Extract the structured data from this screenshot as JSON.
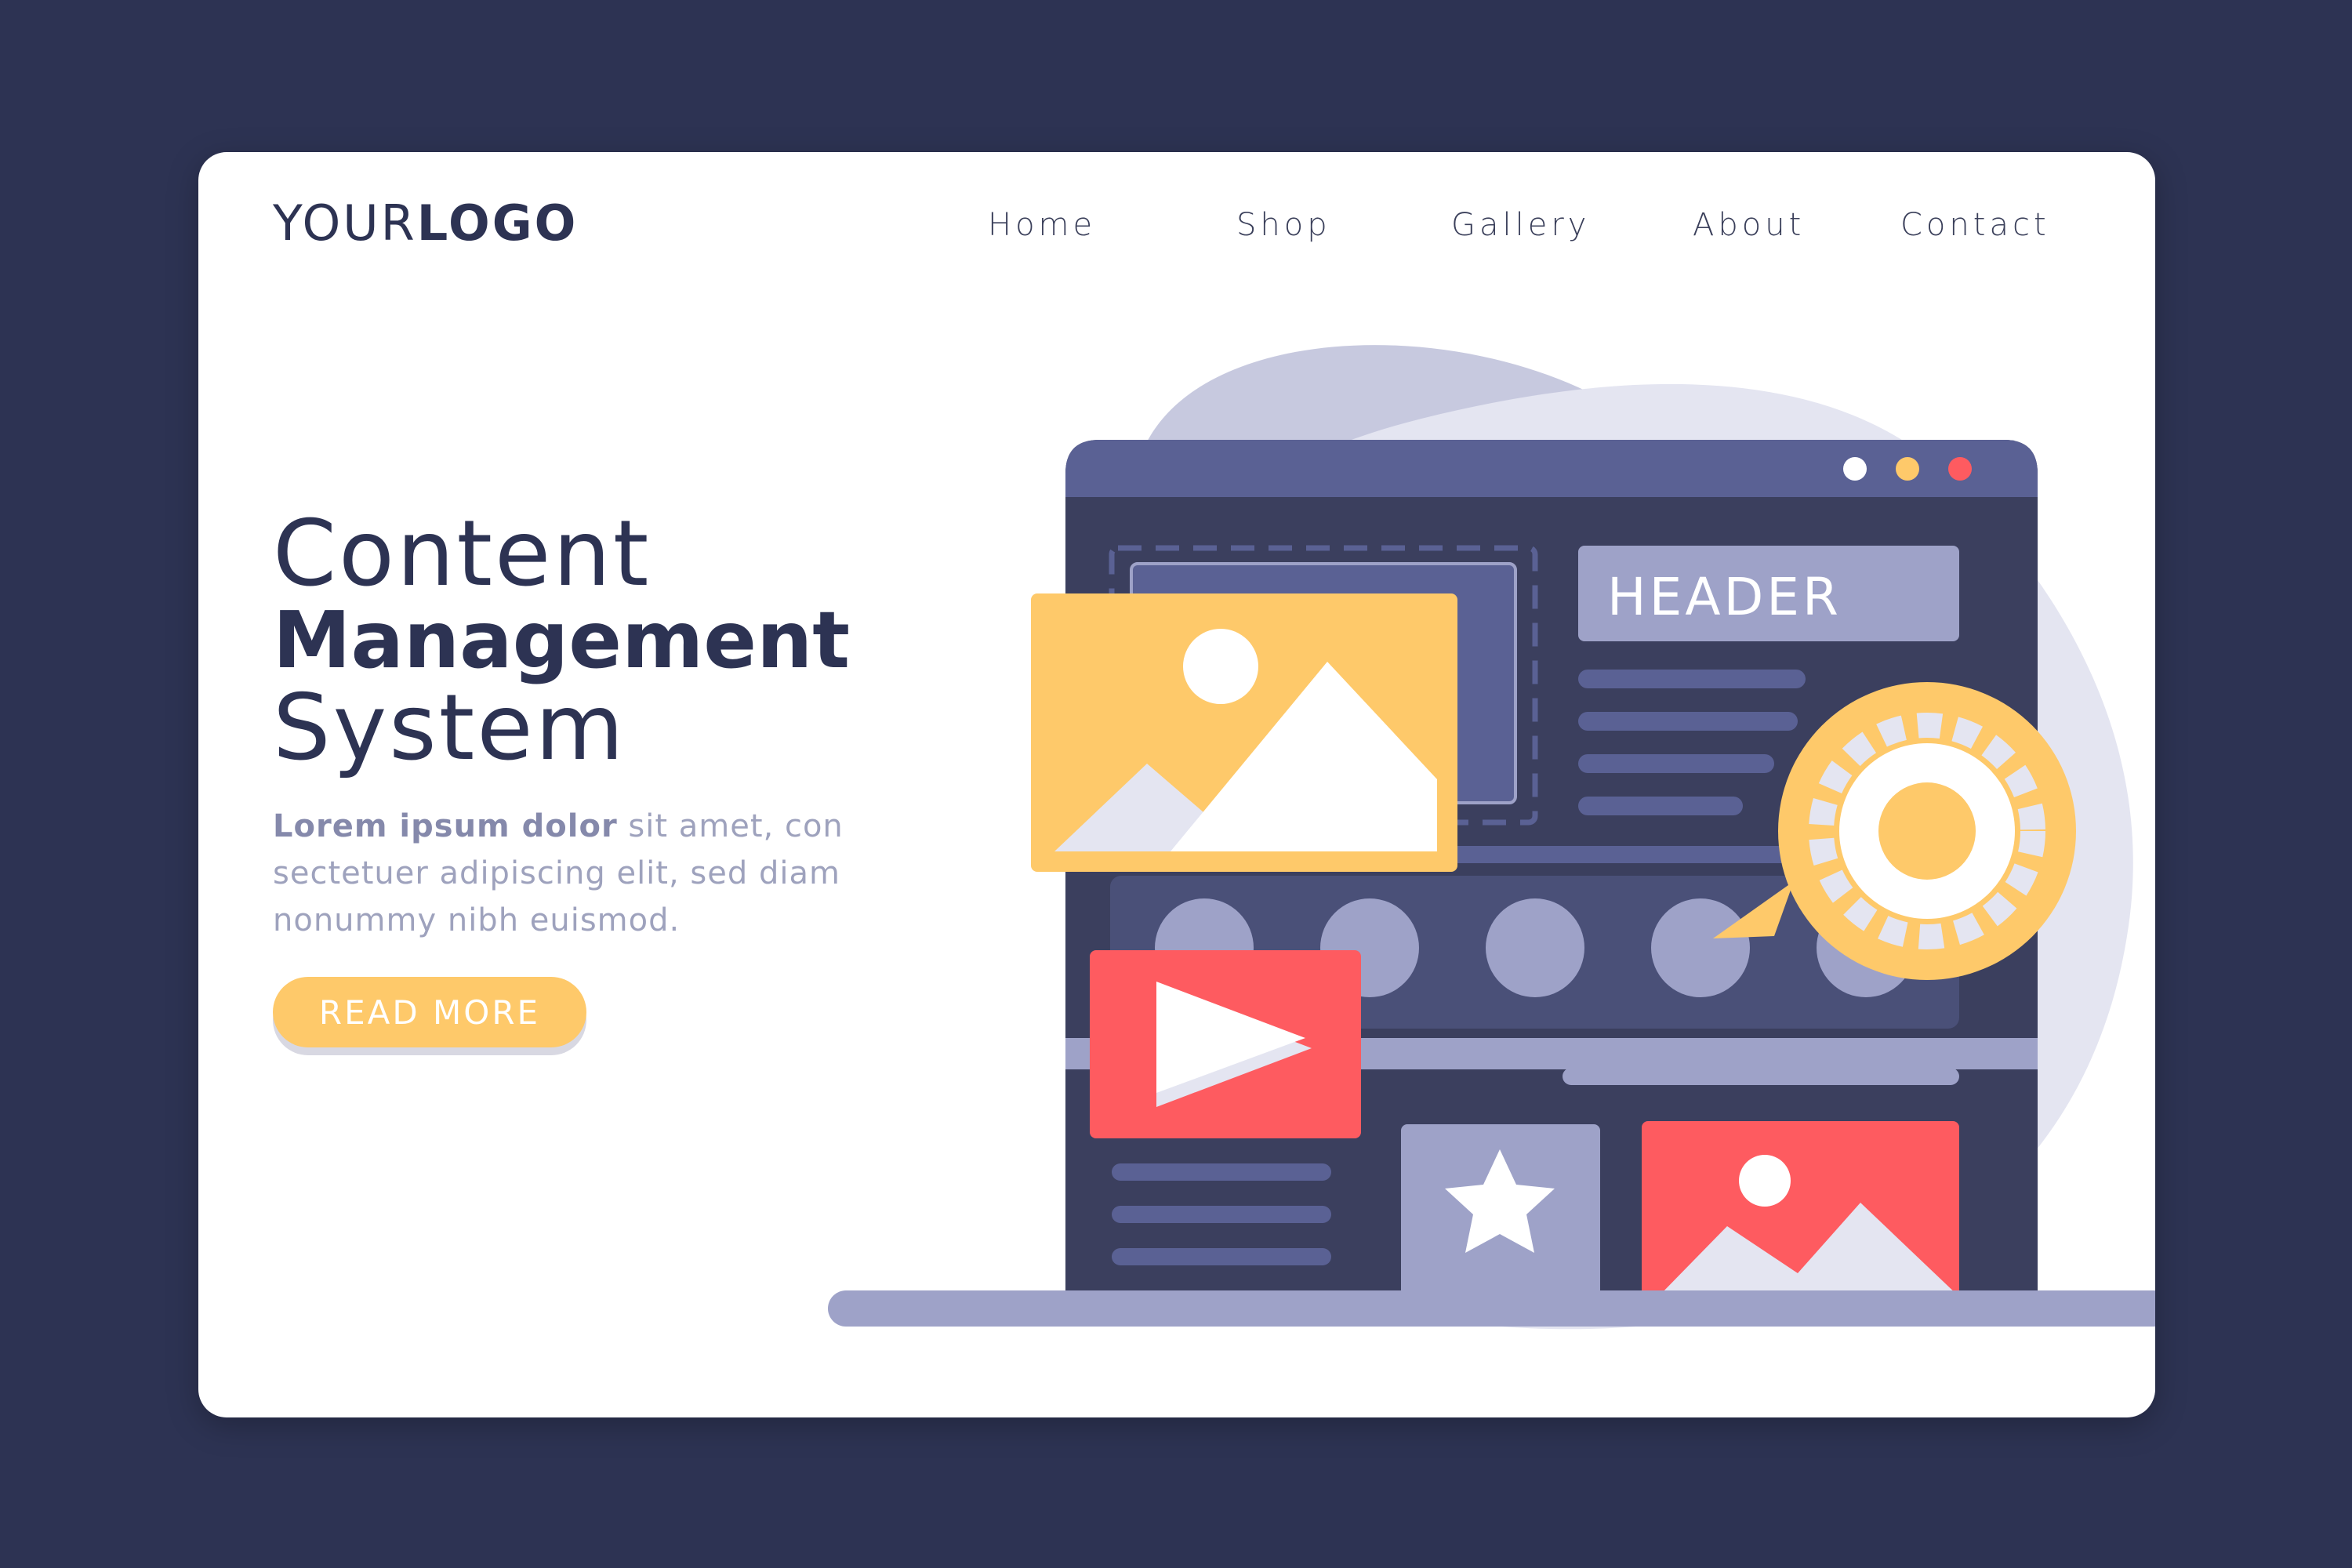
{
  "logo": {
    "light": "YOUR",
    "bold": "LOGO"
  },
  "nav": [
    {
      "label": "Home"
    },
    {
      "label": "Shop"
    },
    {
      "label": "Gallery"
    },
    {
      "label": "About"
    },
    {
      "label": "Contact"
    }
  ],
  "hero": {
    "title_line1": "Content",
    "title_line2": "Management",
    "title_line3": "System",
    "desc_bold": "Lorem ipsum dolor",
    "desc_rest": " sit amet, con sectetuer adipiscing elit, sed diam nonummy nibh euismod.",
    "cta_label": "READ MORE"
  },
  "illustration": {
    "header_label": "HEADER",
    "icons": [
      "window-dot-white-icon",
      "window-dot-yellow-icon",
      "window-dot-red-icon",
      "image-icon",
      "play-icon",
      "gear-icon",
      "star-icon"
    ]
  },
  "colors": {
    "background": "#2d3353",
    "card": "#ffffff",
    "navy": "#2d3353",
    "panel_dark": "#3b3f5e",
    "panel_mid": "#5a6194",
    "lavender": "#9ea2c8",
    "yellow": "#fec96a",
    "red": "#fe5b60",
    "blob": "#e6e7f2"
  }
}
